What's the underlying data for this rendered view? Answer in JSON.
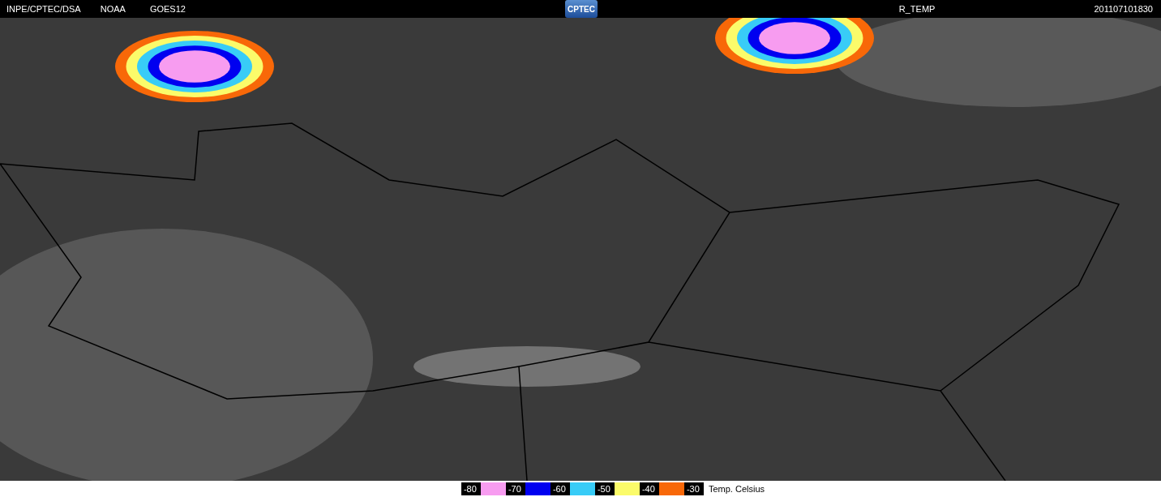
{
  "header": {
    "source": "INPE/CPTEC/DSA",
    "agency": "NOAA",
    "satellite": "GOES12",
    "logo": "CPTEC",
    "product": "R_TEMP",
    "timestamp": "201107101830"
  },
  "legend": {
    "steps": [
      {
        "label": "-80",
        "color": "#f79cf0"
      },
      {
        "label": "-70",
        "color": "#0000f0"
      },
      {
        "label": "-60",
        "color": "#38ccf7"
      },
      {
        "label": "-50",
        "color": "#fbfb6a"
      },
      {
        "label": "-40",
        "color": "#f86808"
      },
      {
        "label": "-30"
      }
    ],
    "unit": "Temp. Celsius"
  }
}
